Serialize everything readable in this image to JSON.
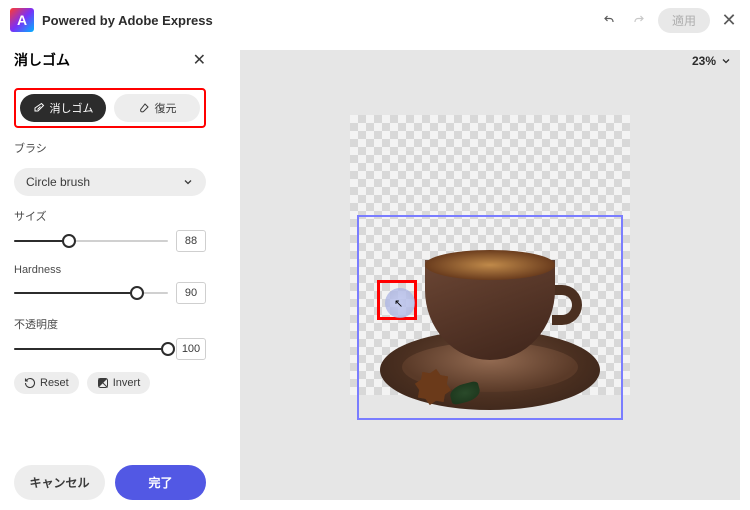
{
  "header": {
    "title": "Powered by Adobe Express",
    "apply_label": "適用"
  },
  "zoom": {
    "label": "23%"
  },
  "tool": {
    "title": "消しゴム",
    "modes": {
      "erase": "消しゴム",
      "restore": "復元"
    }
  },
  "brush": {
    "label": "ブラシ",
    "selected": "Circle brush"
  },
  "sliders": {
    "size": {
      "label": "サイズ",
      "value": "88",
      "pct": 36
    },
    "hardness": {
      "label": "Hardness",
      "value": "90",
      "pct": 80
    },
    "opacity": {
      "label": "不透明度",
      "value": "100",
      "pct": 100
    }
  },
  "actions": {
    "reset": "Reset",
    "invert": "Invert",
    "cancel": "キャンセル",
    "done": "完了"
  }
}
